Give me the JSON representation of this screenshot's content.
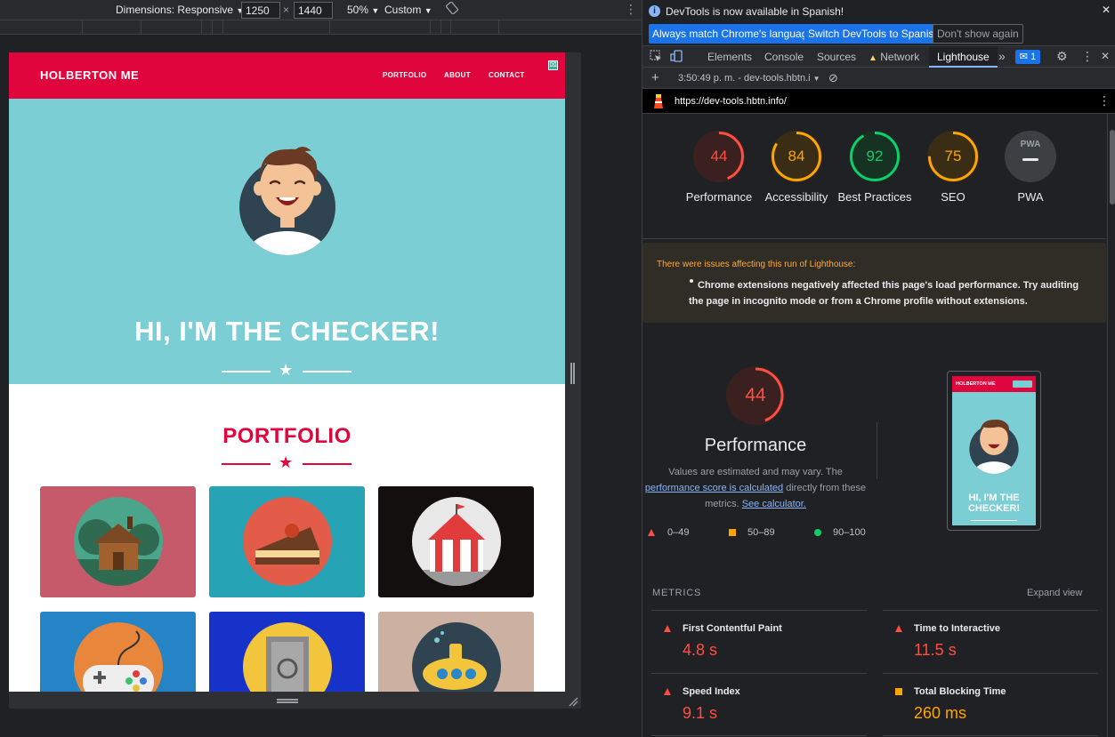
{
  "device_toolbar": {
    "dimensions_label": "Dimensions: Responsive",
    "width": "1250",
    "times": "×",
    "height": "1440",
    "zoom": "50%",
    "throttle": "Custom"
  },
  "site": {
    "brand": "HOLBERTON ME",
    "nav": [
      "PORTFOLIO",
      "ABOUT",
      "CONTACT"
    ],
    "hero_title": "HI, I'M THE CHECKER!",
    "portfolio_title": "PORTFOLIO",
    "colors": {
      "primary": "#e0053d",
      "hero": "#7bced3"
    }
  },
  "devtools": {
    "info_text": "DevTools is now available in Spanish!",
    "btn_match": "Always match Chrome's language",
    "btn_switch": "Switch DevTools to Spanish",
    "btn_dismiss": "Don't show again",
    "tabs": [
      "Elements",
      "Console",
      "Sources",
      "Network",
      "Lighthouse"
    ],
    "more_tabs": "»",
    "messages_count": "1",
    "run_label": "3:50:49 p. m. - dev-tools.hbtn.i",
    "url": "https://dev-tools.hbtn.info/"
  },
  "lighthouse": {
    "scores": [
      {
        "label": "Performance",
        "value": 44,
        "color": "#ff4e42"
      },
      {
        "label": "Accessibility",
        "value": 84,
        "color": "#ffa400"
      },
      {
        "label": "Best Practices",
        "value": 92,
        "color": "#0cce6b"
      },
      {
        "label": "SEO",
        "value": 75,
        "color": "#ffa400"
      },
      {
        "label": "PWA",
        "value": null,
        "color": "#9aa0a6"
      }
    ],
    "pwa_badge": "PWA",
    "warning_title": "There were issues affecting this run of Lighthouse:",
    "warning_body": "Chrome extensions negatively affected this page's load performance. Try auditing the page in incognito mode or from a Chrome profile without extensions.",
    "perf_value": "44",
    "perf_title": "Performance",
    "perf_desc_1": "Values are estimated and may vary. The",
    "perf_link_1": "performance score is calculated",
    "perf_desc_2": "directly from these metrics.",
    "perf_link_2": "See calculator.",
    "legend": [
      "0–49",
      "50–89",
      "90–100"
    ],
    "thumb_brand": "HOLBERTON ME",
    "thumb_title": "HI, I'M THE CHECKER!",
    "metrics_heading": "METRICS",
    "expand_label": "Expand view",
    "metrics": [
      {
        "name": "First Contentful Paint",
        "value": "4.8 s",
        "rating": "fail"
      },
      {
        "name": "Time to Interactive",
        "value": "11.5 s",
        "rating": "fail"
      },
      {
        "name": "Speed Index",
        "value": "9.1 s",
        "rating": "fail"
      },
      {
        "name": "Total Blocking Time",
        "value": "260 ms",
        "rating": "average"
      }
    ]
  }
}
